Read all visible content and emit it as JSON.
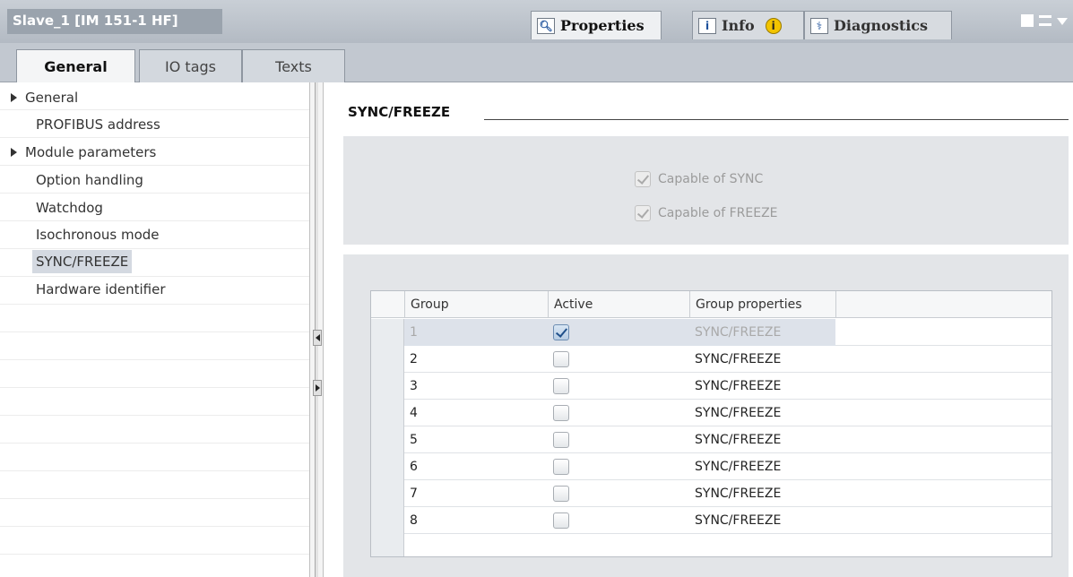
{
  "window": {
    "title": "Slave_1 [IM 151-1 HF]",
    "tabs": [
      {
        "label": "Properties",
        "icon": "properties-icon",
        "active": true
      },
      {
        "label": "Info",
        "icon": "info-icon",
        "badge": "i",
        "active": false
      },
      {
        "label": "Diagnostics",
        "icon": "diagnostics-icon",
        "active": false
      }
    ]
  },
  "subtabs": [
    {
      "label": "General",
      "active": true
    },
    {
      "label": "IO tags",
      "active": false
    },
    {
      "label": "Texts",
      "active": false
    }
  ],
  "nav": {
    "items": [
      {
        "label": "General",
        "expandable": true
      },
      {
        "label": "PROFIBUS address",
        "expandable": false
      },
      {
        "label": "Module parameters",
        "expandable": true
      },
      {
        "label": "Option handling",
        "expandable": false
      },
      {
        "label": "Watchdog",
        "expandable": false
      },
      {
        "label": "Isochronous mode",
        "expandable": false
      },
      {
        "label": "SYNC/FREEZE",
        "expandable": false,
        "selected": true
      },
      {
        "label": "Hardware identifier",
        "expandable": false
      }
    ]
  },
  "section": {
    "title": "SYNC/FREEZE"
  },
  "capabilities": {
    "sync": {
      "label": "Capable of SYNC",
      "checked": true,
      "enabled": false
    },
    "freeze": {
      "label": "Capable of FREEZE",
      "checked": true,
      "enabled": false
    }
  },
  "table": {
    "columns": [
      "Group",
      "Active",
      "Group properties"
    ],
    "rows": [
      {
        "group": "1",
        "active": true,
        "properties": "SYNC/FREEZE",
        "selected": true
      },
      {
        "group": "2",
        "active": false,
        "properties": "SYNC/FREEZE"
      },
      {
        "group": "3",
        "active": false,
        "properties": "SYNC/FREEZE"
      },
      {
        "group": "4",
        "active": false,
        "properties": "SYNC/FREEZE"
      },
      {
        "group": "5",
        "active": false,
        "properties": "SYNC/FREEZE"
      },
      {
        "group": "6",
        "active": false,
        "properties": "SYNC/FREEZE"
      },
      {
        "group": "7",
        "active": false,
        "properties": "SYNC/FREEZE"
      },
      {
        "group": "8",
        "active": false,
        "properties": "SYNC/FREEZE"
      }
    ]
  },
  "colors": {
    "accent": "#2d5f98",
    "titlebar": "#9aa3ad",
    "panel": "#e3e5e8"
  }
}
